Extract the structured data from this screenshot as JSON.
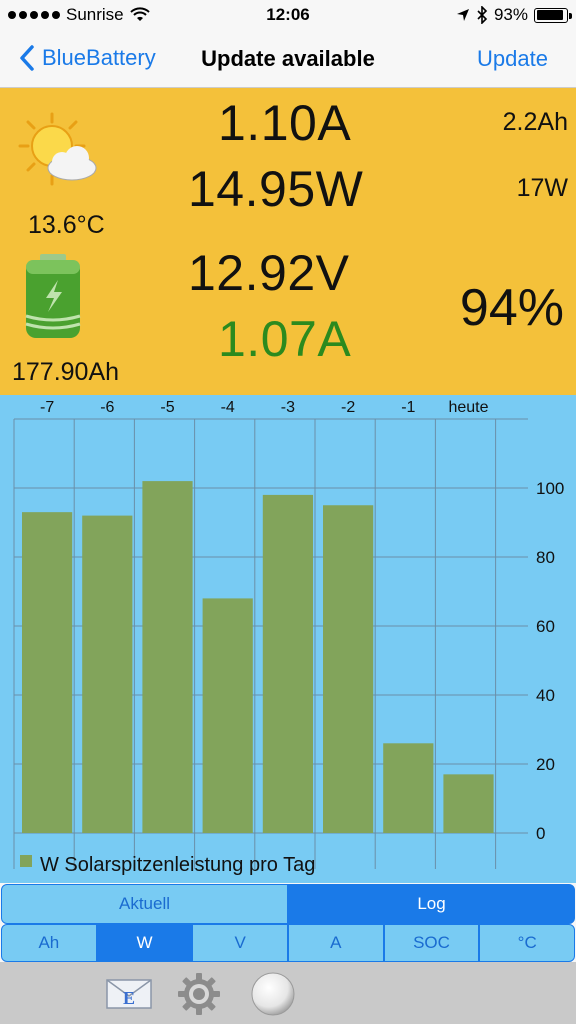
{
  "status_bar": {
    "carrier": "Sunrise",
    "time": "12:06",
    "battery": "93%"
  },
  "nav": {
    "back_label": "BlueBattery",
    "title": "Update available",
    "action_label": "Update"
  },
  "panel": {
    "temperature": "13.6°C",
    "capacity": "177.90Ah",
    "current_in": "1.10A",
    "power": "14.95W",
    "voltage": "12.92V",
    "current_out": "1.07A",
    "ah_side": "2.2Ah",
    "w_side": "17W",
    "soc": "94%",
    "colors": {
      "background": "#f4c13a",
      "current_out": "#2c8a1e"
    }
  },
  "chart_data": {
    "type": "bar",
    "categories": [
      "-7",
      "-6",
      "-5",
      "-4",
      "-3",
      "-2",
      "-1",
      "heute"
    ],
    "values": [
      93,
      92,
      102,
      68,
      98,
      95,
      26,
      17
    ],
    "ylim": [
      0,
      120
    ],
    "yticks": [
      0,
      20,
      40,
      60,
      80,
      100
    ],
    "legend": "W Solarspitzenleistung pro Tag",
    "grid": true,
    "legend_position": "bottom-left",
    "colors": {
      "bar": "#82a45b",
      "background": "#78cbf3",
      "grid": "#6a8fa8"
    }
  },
  "tabs_primary": [
    {
      "label": "Aktuell",
      "selected": false
    },
    {
      "label": "Log",
      "selected": true
    }
  ],
  "tabs_secondary": [
    {
      "label": "Ah",
      "selected": false
    },
    {
      "label": "W",
      "selected": true
    },
    {
      "label": "V",
      "selected": false
    },
    {
      "label": "A",
      "selected": false
    },
    {
      "label": "SOC",
      "selected": false
    },
    {
      "label": "°C",
      "selected": false
    }
  ],
  "toolbar": {
    "mail_letter": "E",
    "icons": [
      "mail-icon",
      "gear-icon",
      "ball-icon"
    ]
  }
}
